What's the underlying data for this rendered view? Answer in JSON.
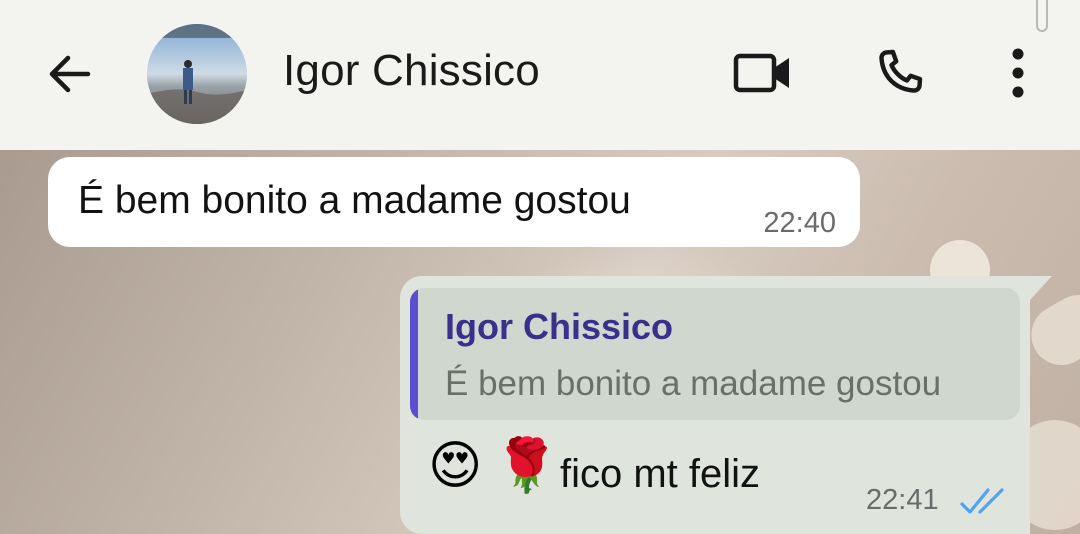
{
  "header": {
    "contact_name": "Igor Chissico"
  },
  "messages": [
    {
      "direction": "incoming",
      "text": "É bem bonito a madame gostou",
      "time": "22:40"
    },
    {
      "direction": "outgoing",
      "quoted": {
        "author": "Igor Chissico",
        "text": "É bem bonito a madame gostou"
      },
      "emojis": [
        "😍",
        "🌹"
      ],
      "text": "fico mt feliz",
      "time": "22:41",
      "status": "read"
    }
  ],
  "colors": {
    "header_bg": "#f3f3ef",
    "incoming_bubble": "#ffffff",
    "outgoing_bubble": "#dfe5dd",
    "quote_bar": "#5a4fcf",
    "quote_author": "#3b2f8c",
    "read_ticks": "#4fa3f7"
  }
}
